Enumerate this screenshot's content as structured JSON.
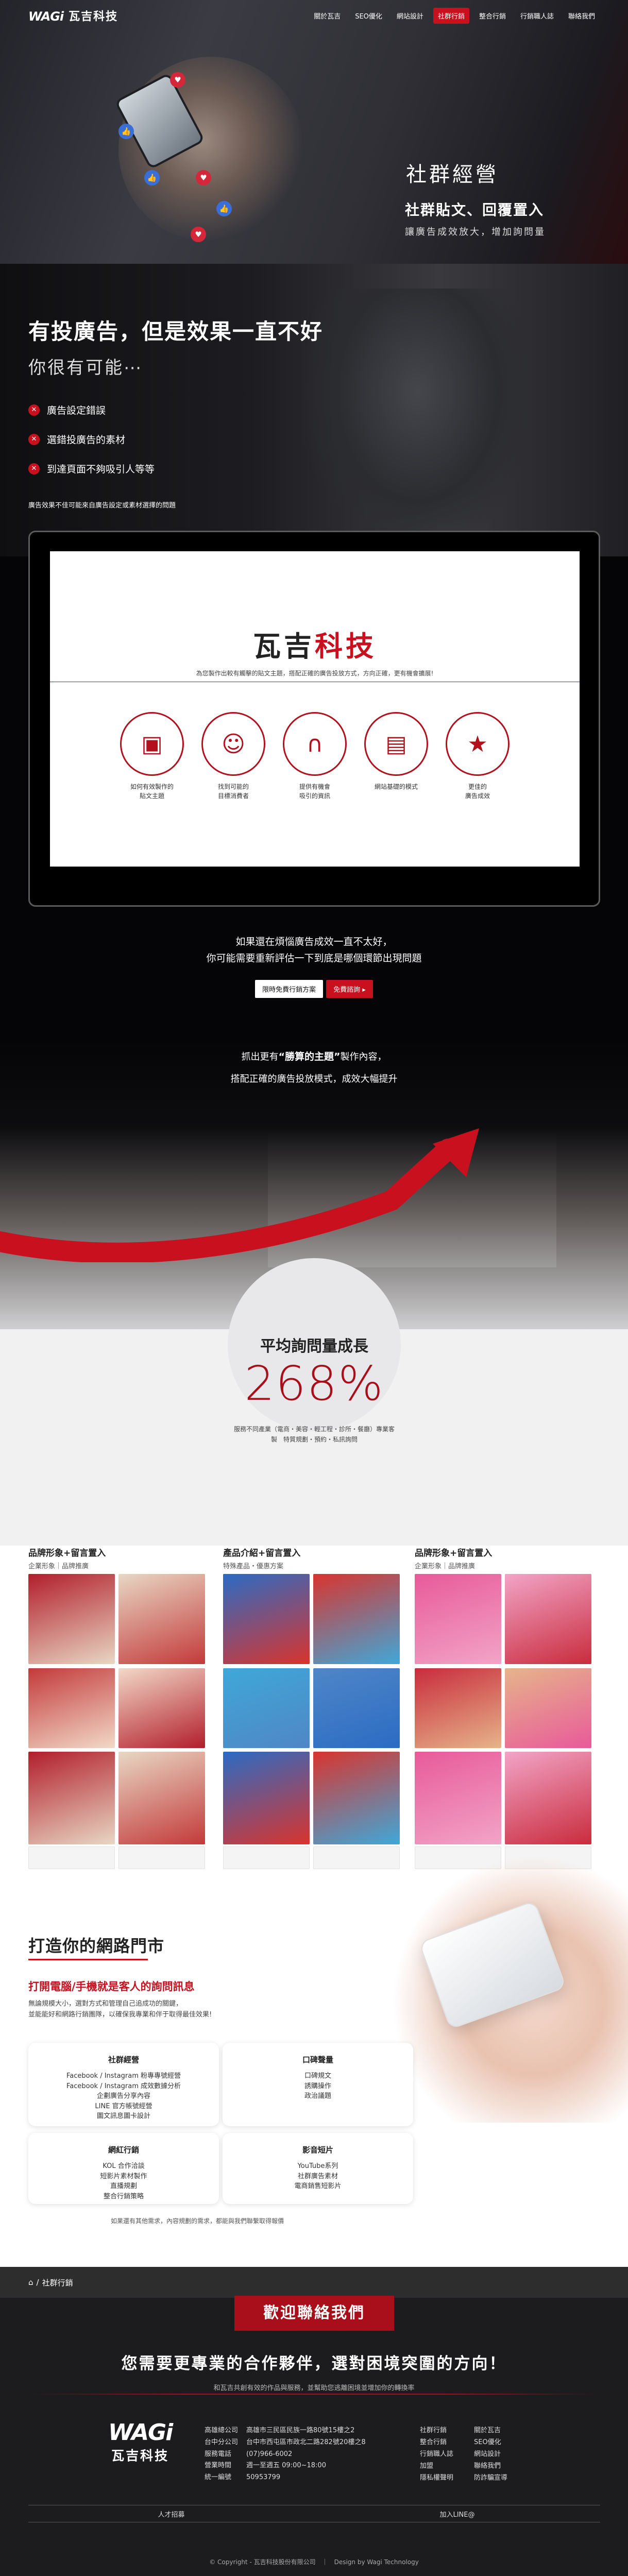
{
  "header": {
    "logo_latin": "WAGi",
    "logo_chinese": "瓦吉科技",
    "nav": [
      {
        "label": "關於瓦吉",
        "active": false
      },
      {
        "label": "SEO優化",
        "active": false
      },
      {
        "label": "網站設計",
        "active": false
      },
      {
        "label": "社群行銷",
        "active": true
      },
      {
        "label": "整合行銷",
        "active": false
      },
      {
        "label": "行銷職人誌",
        "active": false
      },
      {
        "label": "聯絡我們",
        "active": false
      }
    ]
  },
  "hero": {
    "title": "社群經營",
    "subtitle": "社群貼文、回覆置入",
    "tagline": "讓廣告成效放大，增加詢問量"
  },
  "problem": {
    "title": "有投廣告，但是效果一直不好",
    "subtitle": "你很有可能⋯",
    "items": [
      "廣告設定錯誤",
      "選錯投廣告的素材",
      "到達頁面不夠吸引人等等"
    ],
    "note": "廣告效果不佳可能來自廣告設定或素材選擇的問題"
  },
  "screen": {
    "logo_dark": "瓦吉",
    "logo_red": "科技",
    "desc": "為您製作出較有觸擊的貼文主題，搭配正確的廣告投放方式，方向正確，更有機會擴展!",
    "icons": [
      {
        "icon": "device-icon",
        "glyph": "▣",
        "label": "如何有效製作的\n貼文主題"
      },
      {
        "icon": "people-icon",
        "glyph": "☺",
        "label": "找到可能的\n目標消費者"
      },
      {
        "icon": "magnet-icon",
        "glyph": "∩",
        "label": "提供有機會\n吸引的資訊"
      },
      {
        "icon": "layout-icon",
        "glyph": "▤",
        "label": "網站基礎的模式"
      },
      {
        "icon": "rating-icon",
        "glyph": "★",
        "label": "更佳的\n廣告成效"
      }
    ]
  },
  "cta": {
    "line1": "如果還在煩惱廣告成效一直不太好，",
    "line2": "你可能需要重新評估一下到底是哪個環節出現問題",
    "button_left": "限時免費行銷方案",
    "button_right": "免費諮詢 ▸"
  },
  "strategy": {
    "line1_prefix": "抓出更有",
    "line1_bold": "“勝算的主題”",
    "line1_suffix": "製作內容，",
    "line2": "搭配正確的廣告投放模式，成效大幅提升"
  },
  "growth": {
    "title": "平均詢問量成長",
    "value": "268%",
    "desc": "服務不同產業（電商・美容・輕工程・診所・餐廳）專業客製　特質規劃・預約・私訊詢問"
  },
  "portfolio": [
    {
      "title": "品牌形象+留言置入",
      "subtitle": "企業形象｜品牌推廣"
    },
    {
      "title": "產品介紹+留言置入",
      "subtitle": "特殊產品・優惠方案"
    },
    {
      "title": "品牌形象+留言置入",
      "subtitle": "企業形象｜品牌推廣"
    }
  ],
  "portal": {
    "title": "打造你的網路門市",
    "subtitle": "打開電腦/手機就是客人的詢問訊息",
    "desc1": "無論規模大小，選對方式和管理自己追成功的關鍵，",
    "desc2": "並能能好和網路行銷團隊，以確保我專業和伴于取得最佳效果!",
    "cards": [
      {
        "title": "社群經營",
        "lines": [
          "Facebook / Instagram 粉專專號經營",
          "Facebook / Instagram 成效數據分析",
          "企劃廣告分享內容",
          "LINE 官方帳號經營",
          "圖文訊息圖卡設計"
        ]
      },
      {
        "title": "口碑聲量",
        "lines": [
          "口碑規文",
          "誘購操作",
          "政治議題"
        ]
      },
      {
        "title": "網紅行銷",
        "lines": [
          "KOL 合作洽談",
          "短影片素材製作",
          "直播規劃",
          "整合行銷策略"
        ]
      },
      {
        "title": "影音短片",
        "lines": [
          "YouTube系列",
          "社群廣告素材",
          "電商銷售短影片"
        ]
      }
    ],
    "footnote": "如果還有其他需求，內容規劃的需求，都能與我們聯繫取得報價"
  },
  "breadcrumb": {
    "home": "⌂",
    "separator": "/",
    "current": "社群行銷"
  },
  "footer": {
    "contact_button": "歡迎聯絡我們",
    "headline": "您需要更專業的合作夥伴，選對困境突圍的方向！",
    "tagline": "和瓦吉共創有效的作品與服務，並幫助您逃離困境並增加你的轉換率",
    "logo_latin": "WAGi",
    "logo_chinese": "瓦吉科技",
    "info": [
      [
        "高雄總公司",
        "高雄市三民區民族一路80號15樓之2"
      ],
      [
        "台中分公司",
        "台中市西屯區市政北二路282號20樓之8"
      ],
      [
        "服務電話",
        "(07)966-6002"
      ],
      [
        "營業時間",
        "週一至週五 09:00~18:00"
      ],
      [
        "統一編號",
        "50953799"
      ]
    ],
    "links": [
      "社群行銷",
      "關於瓦吉",
      "整合行銷",
      "SEO優化",
      "行銷職人誌",
      "網站設計",
      "加盟",
      "聯絡我們",
      "隱私權聲明",
      "防詐騙宣導"
    ],
    "bottom_left": "人才招募",
    "bottom_right": "加入LINE@",
    "copyright": "© Copyright - 瓦吉科技股份有限公司　｜　Design by Wagi Technology"
  },
  "colors": {
    "accent": "#c8101e",
    "dark": "#1c1c1e"
  }
}
